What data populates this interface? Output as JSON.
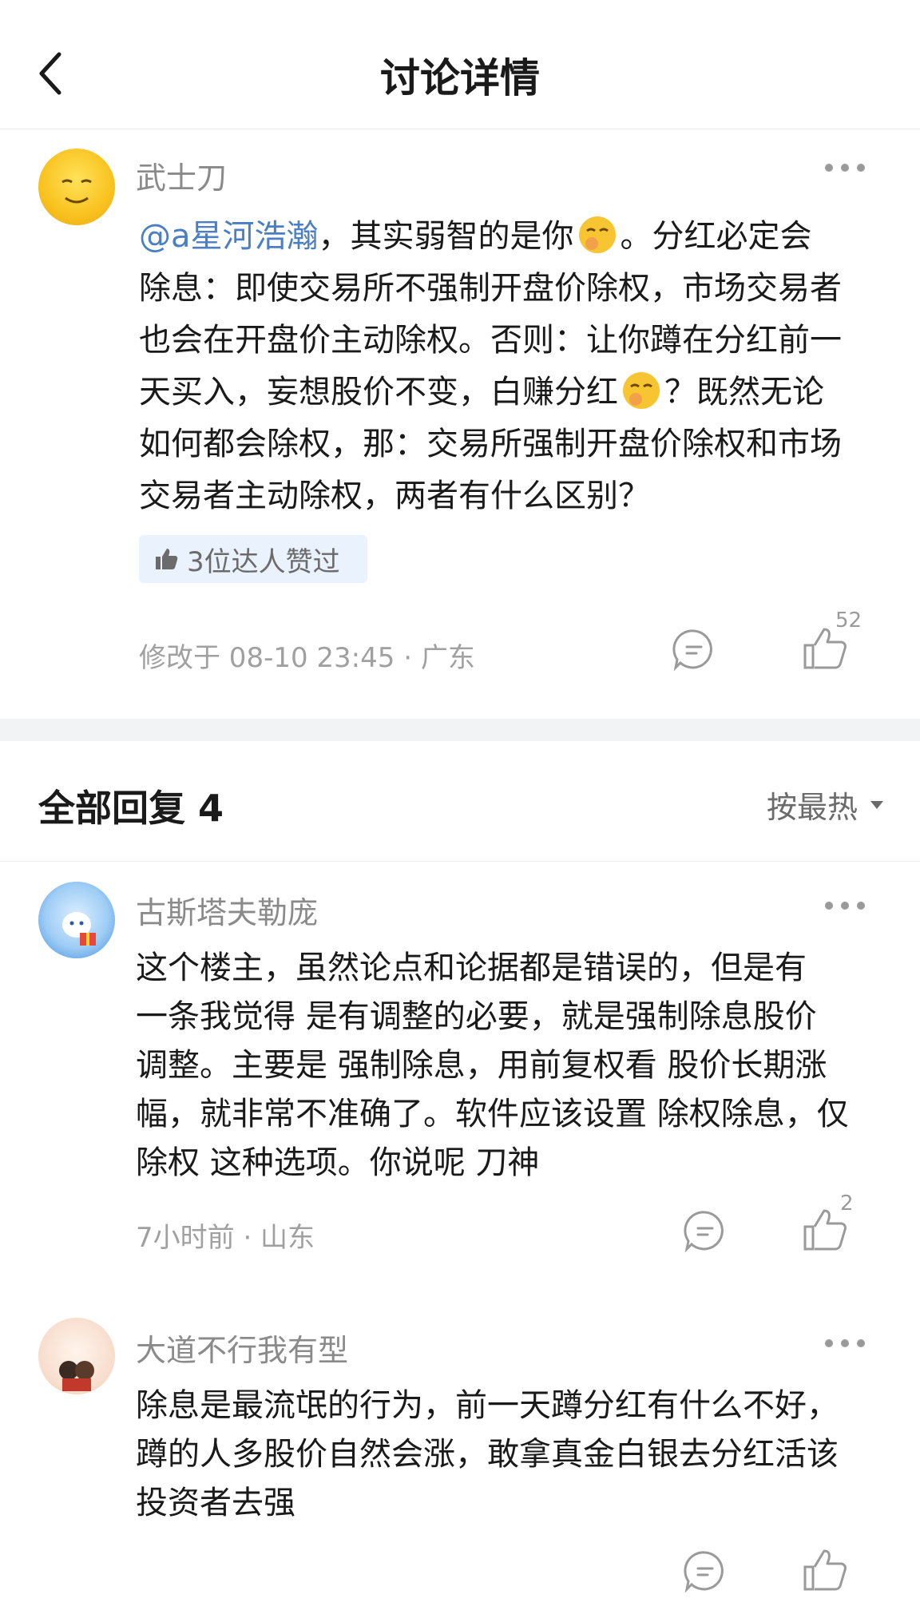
{
  "header": {
    "title": "讨论详情"
  },
  "post": {
    "author": "武士刀",
    "mention": "@a星河浩瀚",
    "lines": [
      "，其实弱智的是你",
      "。分红必定会",
      "除息：即使交易所不强制开盘价除权，市场交易者",
      "也会在开盘价主动除权。否则：让你蹲在分红前一",
      "天买入，妄想股价不变，白赚分红",
      "？既然无论",
      "如何都会除权，那：交易所强制开盘价除权和市场",
      "交易者主动除权，两者有什么区别？"
    ],
    "likers_text": "3位达人赞过",
    "meta": "修改于 08-10 23:45 · 广东",
    "like_count": "52"
  },
  "replies_header": {
    "title": "全部回复 4",
    "sort_label": "按最热"
  },
  "replies": [
    {
      "author": "古斯塔夫勒庞",
      "lines": [
        "这个楼主，虽然论点和论据都是错误的，但是有",
        "一条我觉得 是有调整的必要，就是强制除息股价",
        "调整。主要是 强制除息，用前复权看 股价长期涨",
        "幅，就非常不准确了。软件应该设置 除权除息，仅",
        "除权 这种选项。你说呢 刀神"
      ],
      "meta": "7小时前 · 山东",
      "like_count": "2"
    },
    {
      "author": "大道不行我有型",
      "lines": [
        "除息是最流氓的行为，前一天蹲分红有什么不好，",
        "蹲的人多股价自然会涨，敢拿真金白银去分红活该",
        "投资者去强"
      ]
    }
  ],
  "colors": {
    "mention": "#4a7fc4",
    "likers_bg": "#eaf2fd",
    "muted": "#a0a0a0"
  },
  "icons": [
    "back-arrow-icon",
    "more-dots-icon",
    "thumbs-up-icon",
    "comment-icon",
    "like-icon",
    "sort-triangle-icon",
    "smirk-emoji-icon"
  ]
}
